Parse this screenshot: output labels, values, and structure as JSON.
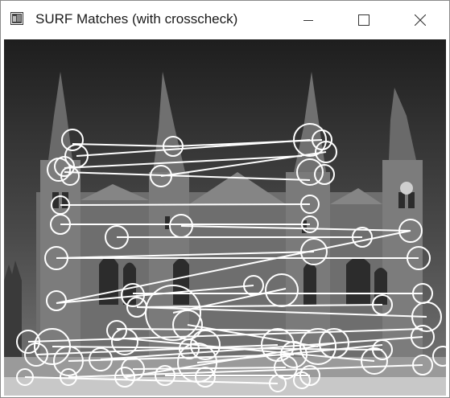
{
  "window": {
    "title": "SURF Matches (with crosscheck)",
    "icons": {
      "app": "image-window-icon",
      "minimize": "minimize-icon",
      "maximize": "maximize-icon",
      "close": "close-icon"
    }
  },
  "canvas": {
    "description_visible": false,
    "match_color": "#ffffff",
    "sky_top": "#2a2a2a",
    "sky_bottom": "#6a6a6a"
  }
}
